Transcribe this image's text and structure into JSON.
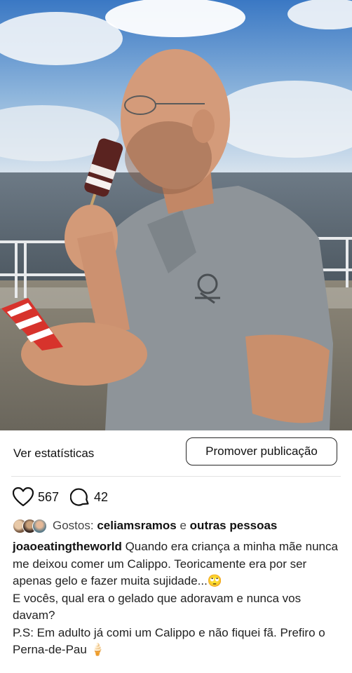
{
  "post": {
    "photo_icon": "photo",
    "stats_label": "Ver estatísticas",
    "promote_label": "Promover publicação",
    "likes_count": "567",
    "comments_count": "42",
    "likes_prefix": "Gostos:",
    "likes_user": "celiamsramos",
    "likes_conj": "e",
    "likes_others": "outras pessoas",
    "username": "joaoeatingtheworld",
    "caption_line1": "Quando era criança a minha mãe nunca me deixou comer um Calippo. Teoricamente era por ser apenas gelo e fazer muita sujidade...🙄",
    "caption_line2": "E vocês, qual era o gelado que adoravam e nunca vos davam?",
    "caption_line3": "P.S: Em adulto já comi um Calippo e não fiquei fã. Prefiro o Perna-de-Pau 🍦"
  },
  "colors": {
    "text": "#111111",
    "secondary_text": "#444444",
    "divider": "#e3e3e3"
  },
  "icons": [
    "heart-icon",
    "comment-icon"
  ]
}
